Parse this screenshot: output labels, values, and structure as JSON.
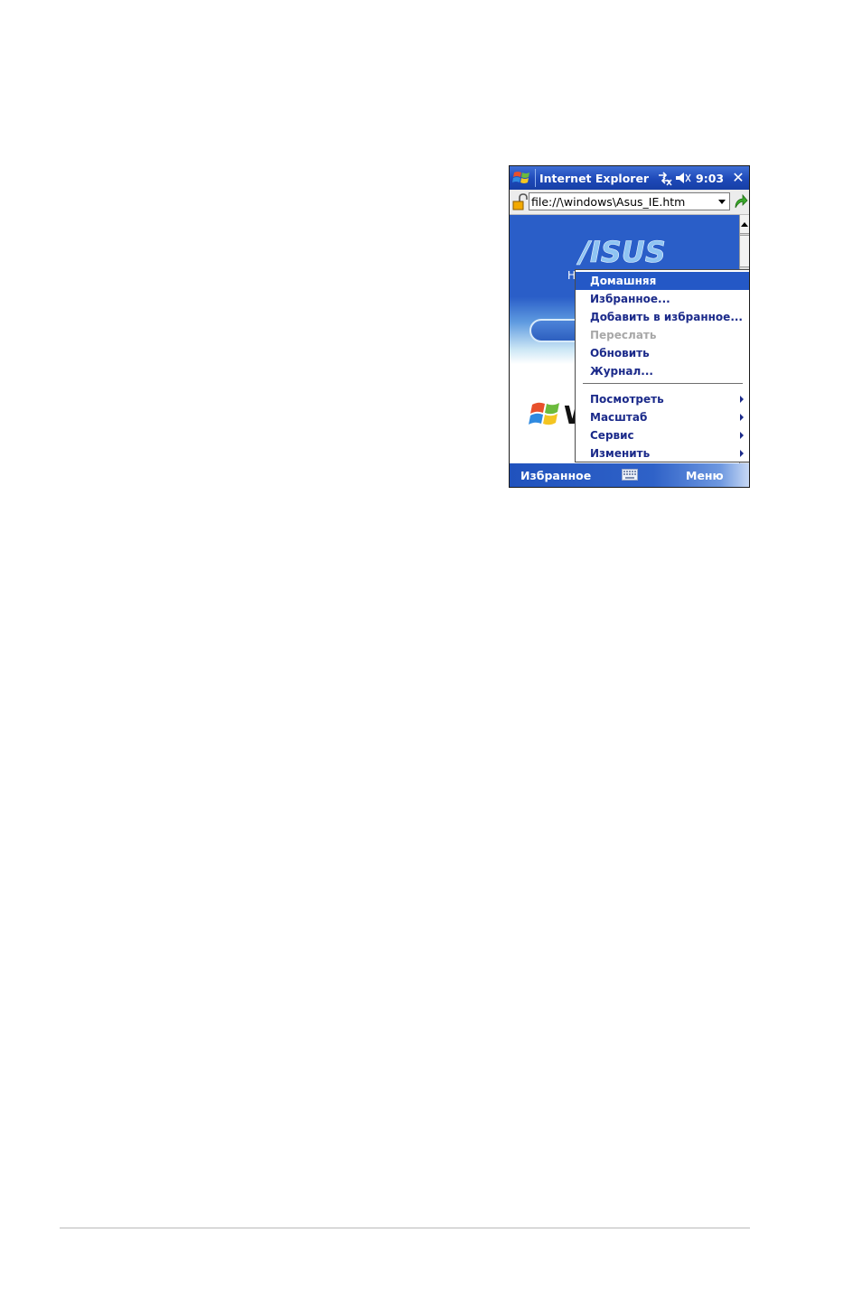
{
  "titlebar": {
    "app_title": "Internet Explorer",
    "clock": "9:03",
    "close_label": "✕"
  },
  "addressbar": {
    "url": "file://\\windows\\Asus_IE.htm"
  },
  "content": {
    "banner_text": "H",
    "logo_text": "/ISUS",
    "winxp_text": "W"
  },
  "menu": {
    "items": [
      {
        "label": "Домашняя",
        "selected": true
      },
      {
        "label": "Избранное..."
      },
      {
        "label": "Добавить в избранное..."
      },
      {
        "label": "Переслать",
        "disabled": true
      },
      {
        "label": "Обновить"
      },
      {
        "label": "Журнал..."
      },
      {
        "label": "Посмотреть",
        "submenu": true
      },
      {
        "label": "Масштаб",
        "submenu": true
      },
      {
        "label": "Сервис",
        "submenu": true
      },
      {
        "label": "Изменить",
        "submenu": true
      }
    ]
  },
  "softkeys": {
    "left": "Избранное",
    "right": "Меню"
  },
  "colors": {
    "titlebar_blue": "#1e49b8",
    "menu_selection": "#2458c6",
    "menu_text": "#1b2a8a"
  },
  "icons": [
    "windows-start-icon",
    "connectivity-icon",
    "speaker-icon",
    "close-icon",
    "lock-icon",
    "dropdown-arrow-icon",
    "go-arrow-icon",
    "keyboard-icon",
    "windows-xp-logo-icon"
  ]
}
